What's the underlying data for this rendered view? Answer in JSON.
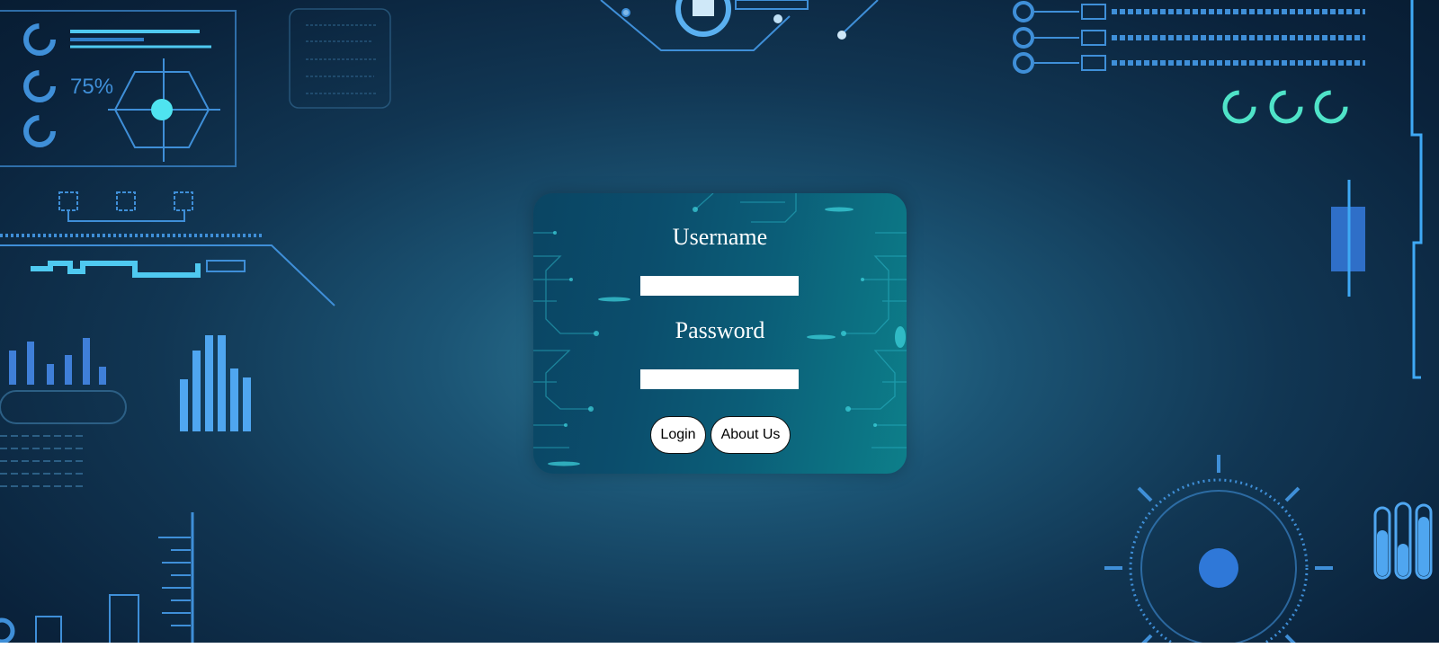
{
  "login_form": {
    "username_label": "Username",
    "username_value": "",
    "password_label": "Password",
    "password_value": "",
    "login_button": "Login",
    "about_button": "About Us"
  },
  "background": {
    "hud_percent": "75%"
  },
  "colors": {
    "card_accent": "#0b5e78",
    "hud_blue": "#3fa9f5",
    "hud_cyan": "#4fe3f0"
  }
}
